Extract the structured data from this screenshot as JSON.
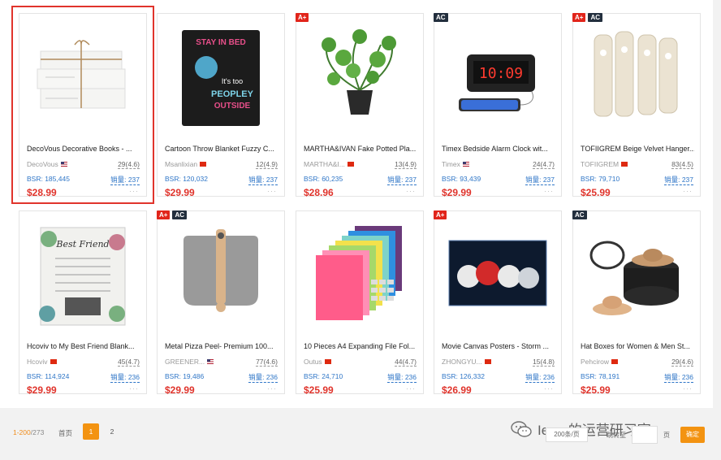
{
  "products": [
    {
      "title": "DecoVous Decorative Books - ...",
      "brand": "DecoVous",
      "flag": "us",
      "rating": "29(4.6)",
      "bsr": "BSR: 185,445",
      "sales": "销量: 237",
      "price": "$28.99",
      "badges": [],
      "selected": true,
      "image": "stacked-books-icon"
    },
    {
      "title": "Cartoon Throw Blanket Fuzzy C...",
      "brand": "Msanlixian",
      "flag": "cn",
      "rating": "12(4.9)",
      "bsr": "BSR: 120,032",
      "sales": "销量: 237",
      "price": "$29.99",
      "badges": [],
      "image": "blanket-icon"
    },
    {
      "title": "MARTHA&IVAN Fake Potted Pla...",
      "brand": "MARTHA&I...",
      "flag": "cn",
      "rating": "13(4.9)",
      "bsr": "BSR: 60,235",
      "sales": "销量: 237",
      "price": "$28.96",
      "badges": [
        "A+"
      ],
      "image": "potted-plant-icon"
    },
    {
      "title": "Timex Bedside Alarm Clock wit...",
      "brand": "Timex",
      "flag": "us",
      "rating": "24(4.7)",
      "bsr": "BSR: 93,439",
      "sales": "销量: 237",
      "price": "$29.99",
      "badges": [
        "AC"
      ],
      "image": "alarm-clock-icon"
    },
    {
      "title": "TOFIIGREM Beige Velvet Hanger...",
      "brand": "TOFIIGREM",
      "flag": "cn",
      "rating": "83(4.5)",
      "bsr": "BSR: 79,710",
      "sales": "销量: 237",
      "price": "$25.99",
      "badges": [
        "A+",
        "AC"
      ],
      "image": "hanger-clips-icon"
    },
    {
      "title": "Hcoviv to My Best Friend Blank...",
      "brand": "Hcoviv",
      "flag": "cn",
      "rating": "45(4.7)",
      "bsr": "BSR: 114,924",
      "sales": "销量: 236",
      "price": "$29.99",
      "badges": [],
      "image": "friend-blanket-icon",
      "image_text": "Best Friend"
    },
    {
      "title": "Metal Pizza Peel- Premium 100...",
      "brand": "GREENER...",
      "flag": "us",
      "rating": "77(4.6)",
      "bsr": "BSR: 19,486",
      "sales": "销量: 236",
      "price": "$29.99",
      "badges": [
        "A+",
        "AC"
      ],
      "image": "pizza-peel-icon"
    },
    {
      "title": "10 Pieces A4 Expanding File Fol...",
      "brand": "Outus",
      "flag": "cn",
      "rating": "44(4.7)",
      "bsr": "BSR: 24,710",
      "sales": "销量: 236",
      "price": "$25.99",
      "badges": [],
      "image": "file-folders-icon"
    },
    {
      "title": "Movie Canvas Posters - Storm ...",
      "brand": "ZHONGYU...",
      "flag": "cn",
      "rating": "15(4.8)",
      "bsr": "BSR: 126,332",
      "sales": "销量: 236",
      "price": "$26.99",
      "badges": [
        "A+"
      ],
      "image": "canvas-poster-icon"
    },
    {
      "title": "Hat Boxes for Women & Men St...",
      "brand": "Pehcirow",
      "flag": "cn",
      "rating": "29(4.6)",
      "bsr": "BSR: 78,191",
      "sales": "销量: 236",
      "price": "$25.99",
      "badges": [
        "AC"
      ],
      "image": "hat-box-icon"
    }
  ],
  "pagination": {
    "range": "1-200",
    "total": "/273",
    "first": "首页",
    "pages": [
      "1",
      "2"
    ],
    "active_page": "1",
    "page_size": "200条/页",
    "goto": "跳转至",
    "page_unit": "页",
    "confirm": "确定"
  },
  "watermark": "Ienry的运营研习室",
  "colors": {
    "price": "#e0342c",
    "bsr": "#2f76c7",
    "accent": "#f39311",
    "selected_border": "#e0342c"
  }
}
